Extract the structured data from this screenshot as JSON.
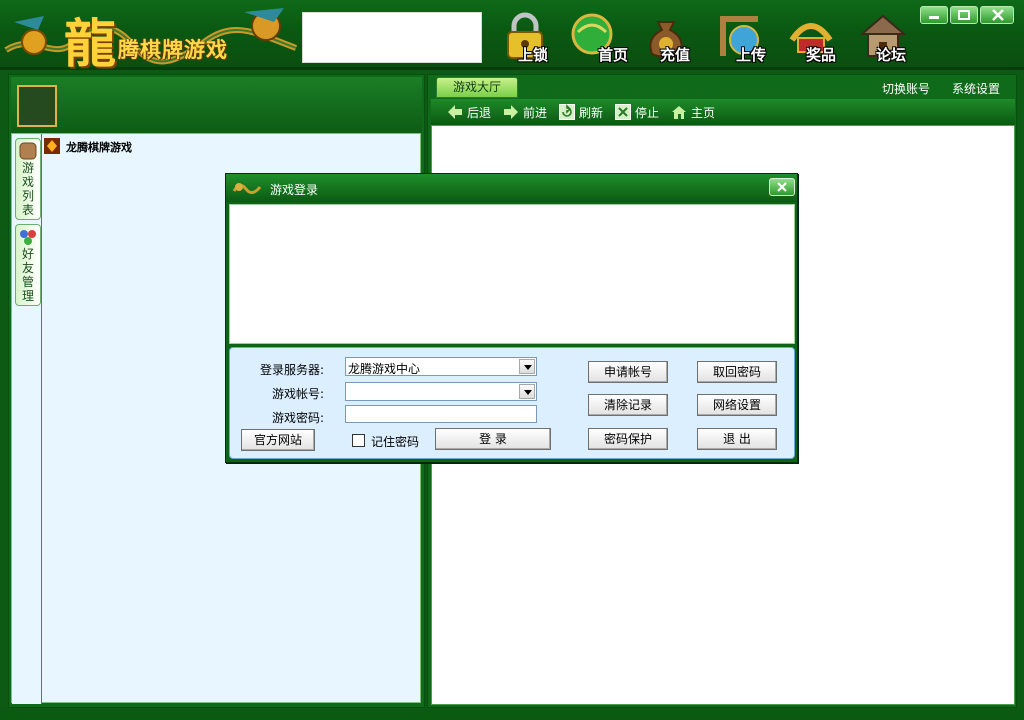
{
  "app": {
    "logo_char": "龍",
    "logo_text": "腾棋牌游戏"
  },
  "toolbar": {
    "buttons": [
      {
        "label": "上锁",
        "icon": "padlock-icon"
      },
      {
        "label": "首页",
        "icon": "home-globe-icon"
      },
      {
        "label": "充值",
        "icon": "money-bag-icon"
      },
      {
        "label": "上传",
        "icon": "upload-icon"
      },
      {
        "label": "奖品",
        "icon": "prize-icon"
      },
      {
        "label": "论坛",
        "icon": "forum-house-icon"
      }
    ]
  },
  "left_panel": {
    "side_tabs": [
      {
        "label": "游戏列表",
        "icon": "game-list-icon"
      },
      {
        "label": "好友管理",
        "icon": "friends-icon"
      }
    ],
    "game_tree": {
      "label": "龙腾棋牌游戏",
      "icon": "game-root-icon"
    }
  },
  "right_panel": {
    "tab": "游戏大厅",
    "links": {
      "switch_account": "切换账号",
      "system_settings": "系统设置"
    },
    "nav": [
      {
        "label": "后退",
        "icon": "back-arrow-icon"
      },
      {
        "label": "前进",
        "icon": "forward-arrow-icon"
      },
      {
        "label": "刷新",
        "icon": "refresh-icon"
      },
      {
        "label": "停止",
        "icon": "stop-icon"
      },
      {
        "label": "主页",
        "icon": "home-icon"
      }
    ]
  },
  "login_dialog": {
    "title": "游戏登录",
    "server_label": "登录服务器:",
    "server_value": "龙腾游戏中心",
    "account_label": "游戏帐号:",
    "account_value": "",
    "password_label": "游戏密码:",
    "password_value": "",
    "official_site": "官方网站",
    "remember_password": "记住密码",
    "login_button": "登 录",
    "apply_account": "申请帐号",
    "retrieve_password": "取回密码",
    "clear_records": "清除记录",
    "network_settings": "网络设置",
    "password_protect": "密码保护",
    "exit": "退 出"
  },
  "colors": {
    "frame_green": "#0d6418",
    "panel_bg": "#e8f7ff",
    "form_bg": "#dcefff",
    "logo_gold": "#ffd84a"
  }
}
